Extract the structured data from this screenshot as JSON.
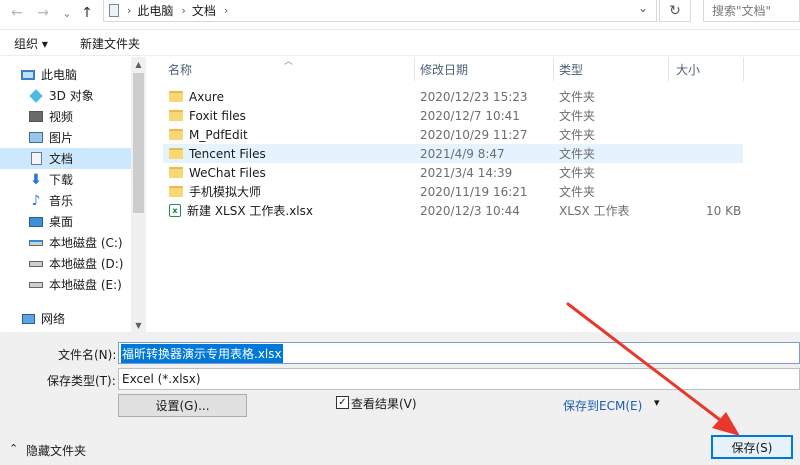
{
  "nav": {
    "back_glyph": "←",
    "forward_glyph": "→",
    "dropdown_glyph": "⌄",
    "up_glyph": "↑"
  },
  "address": {
    "crumbs": [
      "此电脑",
      "文档"
    ],
    "separator": "›",
    "dropdown_glyph": "⌄",
    "refresh_glyph": "↻"
  },
  "search": {
    "placeholder": "搜索\"文档\""
  },
  "toolbar": {
    "organize_label": "组织 ▾",
    "new_folder_label": "新建文件夹"
  },
  "sidebar": {
    "items": [
      {
        "label": "此电脑",
        "icon": "computer-icon"
      },
      {
        "label": "3D 对象",
        "icon": "3d-objects-icon"
      },
      {
        "label": "视频",
        "icon": "video-icon"
      },
      {
        "label": "图片",
        "icon": "pictures-icon"
      },
      {
        "label": "文档",
        "icon": "documents-icon",
        "selected": true
      },
      {
        "label": "下载",
        "icon": "download-icon"
      },
      {
        "label": "音乐",
        "icon": "music-icon"
      },
      {
        "label": "桌面",
        "icon": "desktop-icon"
      },
      {
        "label": "本地磁盘 (C:)",
        "icon": "drive-icon"
      },
      {
        "label": "本地磁盘 (D:)",
        "icon": "drive-icon"
      },
      {
        "label": "本地磁盘 (E:)",
        "icon": "drive-icon"
      },
      {
        "label": "网络",
        "icon": "network-icon"
      }
    ]
  },
  "filelist": {
    "headers": {
      "name": "名称",
      "date": "修改日期",
      "type": "类型",
      "size": "大小"
    },
    "rows": [
      {
        "name": "Axure",
        "date": "2020/12/23 15:23",
        "type": "文件夹",
        "size": "",
        "kind": "folder"
      },
      {
        "name": "Foxit files",
        "date": "2020/12/7 10:41",
        "type": "文件夹",
        "size": "",
        "kind": "folder"
      },
      {
        "name": "M_PdfEdit",
        "date": "2020/10/29 11:27",
        "type": "文件夹",
        "size": "",
        "kind": "folder"
      },
      {
        "name": "Tencent Files",
        "date": "2021/4/9 8:47",
        "type": "文件夹",
        "size": "",
        "kind": "folder",
        "hover": true
      },
      {
        "name": "WeChat Files",
        "date": "2021/3/4 14:39",
        "type": "文件夹",
        "size": "",
        "kind": "folder"
      },
      {
        "name": "手机模拟大师",
        "date": "2020/11/19 16:21",
        "type": "文件夹",
        "size": "",
        "kind": "folder"
      },
      {
        "name": "新建 XLSX 工作表.xlsx",
        "date": "2020/12/3 10:44",
        "type": "XLSX 工作表",
        "size": "10 KB",
        "kind": "xlsx"
      }
    ]
  },
  "save": {
    "filename_label": "文件名(N):",
    "filename_value": "福昕转换器演示专用表格.xlsx",
    "filetype_label": "保存类型(T):",
    "filetype_value": "Excel (*.xlsx)",
    "settings_button": "设置(G)...",
    "view_results_label": "查看结果(V)",
    "view_results_checked": "✓",
    "save_to_ecm": "保存到ECM(E)",
    "ecm_dropdown": "▾",
    "hide_folders": "隐藏文件夹",
    "hide_folders_glyph": "⌃",
    "save_button": "保存(S)"
  },
  "colors": {
    "selection": "#cce8ff",
    "hover": "#e5f3ff",
    "accent": "#0078d7",
    "arrow": "#e8372b"
  }
}
